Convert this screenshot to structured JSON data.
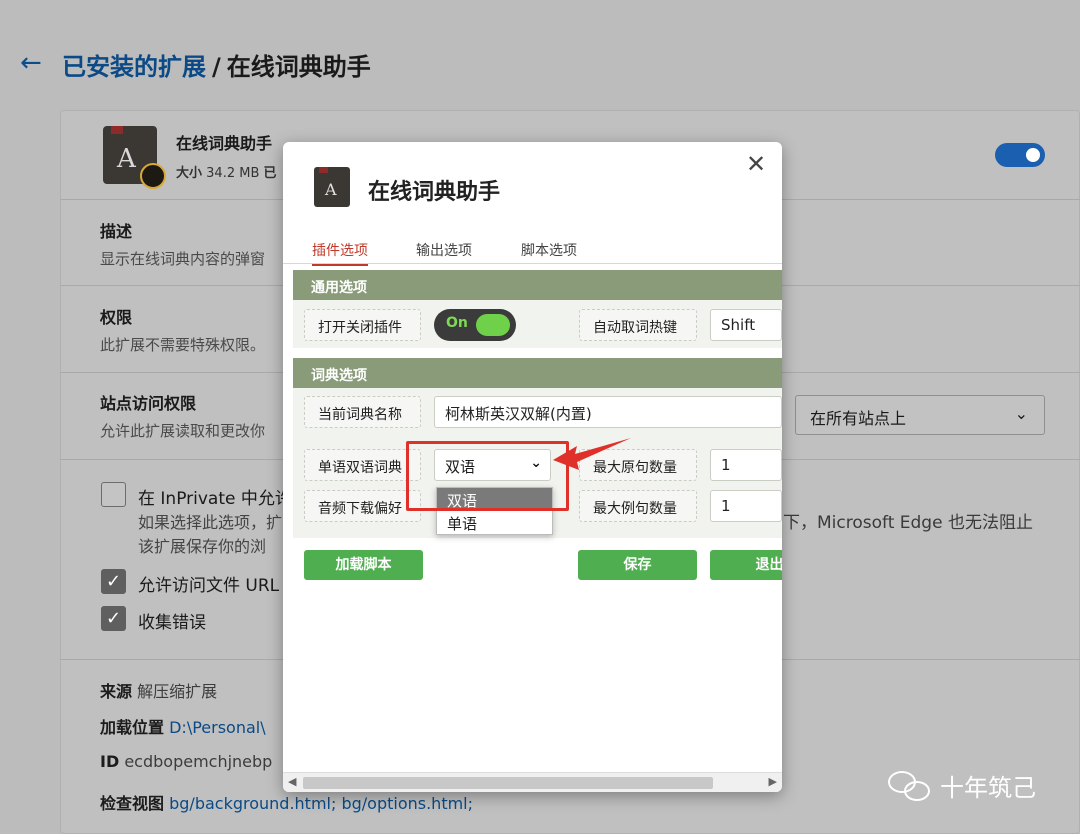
{
  "header": {
    "back_icon": "arrow-left-icon",
    "crumb_link": "已安装的扩展",
    "separator": "/",
    "crumb_current": "在线词典助手"
  },
  "extension": {
    "name": "在线词典助手",
    "size_label": "大小",
    "size_value": "34.2 MB",
    "size_suffix": "已",
    "enabled": true
  },
  "sections": {
    "desc_title": "描述",
    "desc_text": "显示在线词典内容的弹窗",
    "perm_title": "权限",
    "perm_text": "此扩展不需要特殊权限。",
    "site_title": "站点访问权限",
    "site_text": "允许此扩展读取和更改你",
    "site_select_value": "在所有站点上"
  },
  "options": {
    "inprivate_label": "在 InPrivate 中允许",
    "inprivate_sub1": "如果选择此选项，扩",
    "inprivate_sub2": "该扩展保存你的浏",
    "inprivate_right": "下，Microsoft Edge 也无法阻止",
    "file_url_label": "允许访问文件 URL",
    "file_url_checked": true,
    "errors_label": "收集错误",
    "errors_checked": true,
    "checkmark": "✓"
  },
  "meta": {
    "source_label": "来源",
    "source_value": "解压缩扩展",
    "location_label": "加载位置",
    "location_value": "D:\\Personal\\",
    "id_label": "ID",
    "id_value": "ecdbopemchjnebp",
    "inspect_label": "检查视图",
    "inspect_value": "bg/background.html;  bg/options.html;"
  },
  "watermark": "十年筑己",
  "modal": {
    "title": "在线词典助手",
    "close_icon": "close-icon",
    "tabs": [
      "插件选项",
      "输出选项",
      "脚本选项"
    ],
    "active_tab": 0,
    "general_head": "通用选项",
    "toggle_label": "打开关闭插件",
    "toggle_text": "On",
    "hotkey_label": "自动取词热键",
    "hotkey_value": "Shift",
    "dict_head": "词典选项",
    "current_dict_label": "当前词典名称",
    "current_dict_value": "柯林斯英汉双解(内置)",
    "mode_label": "单语双语词典",
    "mode_value": "双语",
    "mode_options": [
      "双语",
      "单语"
    ],
    "max_orig_label": "最大原句数量",
    "max_orig_value": "1",
    "audio_label": "音频下载偏好",
    "max_example_label": "最大例句数量",
    "max_example_value": "1",
    "btn_load": "加载脚本",
    "btn_save": "保存",
    "btn_exit": "退出",
    "highlight_color": "#e0302a",
    "accent_green": "#4fae4f"
  }
}
